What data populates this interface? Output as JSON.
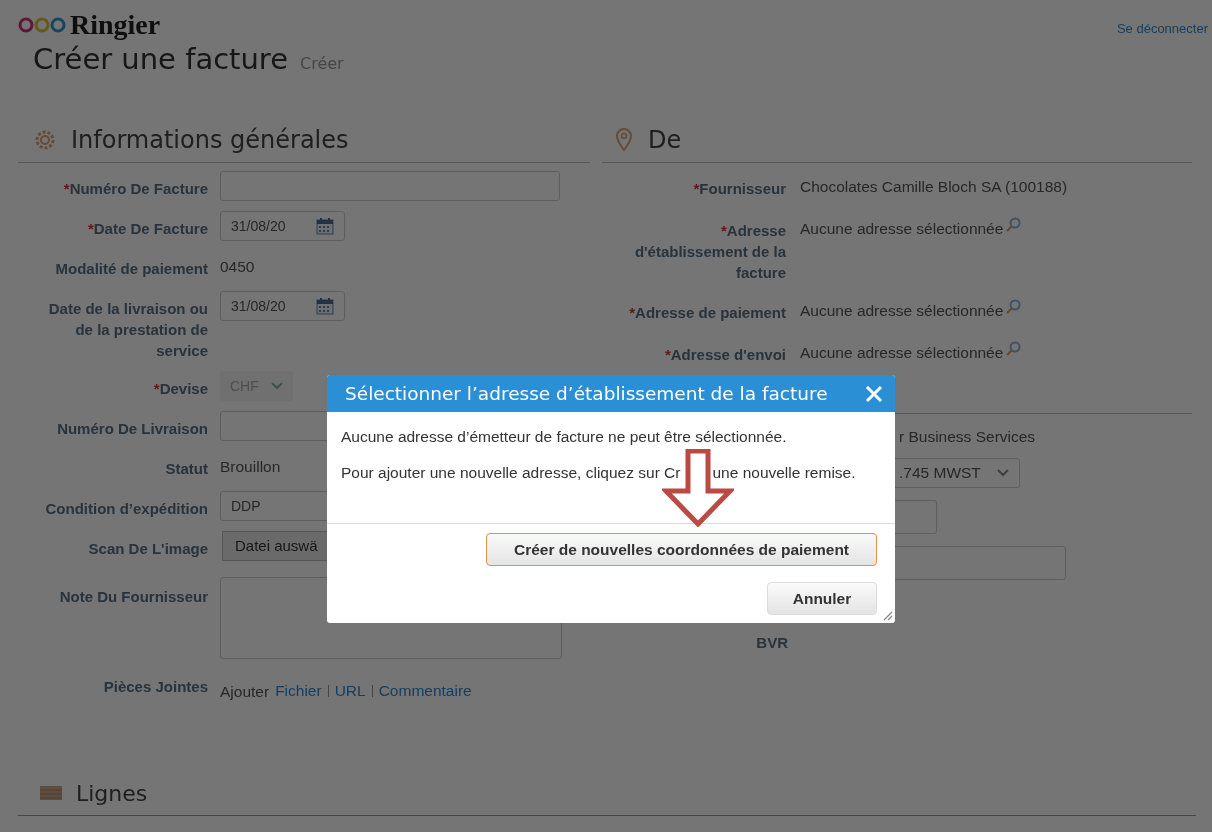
{
  "header": {
    "logo": "Ringier",
    "logout": "Se déconnecter"
  },
  "title": "Créer une facture",
  "subtitle": "Créer",
  "general": {
    "title": "Informations générales",
    "fields": [
      {
        "kind": "input",
        "mark": "*",
        "label": "Numéro De Facture"
      },
      {
        "kind": "date",
        "mark": "*",
        "label": "Date De Facture",
        "value": "31/08/20"
      },
      {
        "kind": "text",
        "label": "Modalité de paiement",
        "value": "0450"
      },
      {
        "kind": "date",
        "label": "Date de la livraison ou de la prestation de service",
        "value": "31/08/20"
      },
      {
        "kind": "select",
        "mark": "*",
        "label": "Devise",
        "value": "CHF"
      },
      {
        "kind": "input",
        "label": "Numéro De Livraison"
      },
      {
        "kind": "text",
        "label": "Statut",
        "value": "Brouillon"
      },
      {
        "kind": "input",
        "label": "Condition d’expédition",
        "value": "DDP"
      },
      {
        "kind": "file",
        "label": "Scan De L'image",
        "value": "Datei auswä"
      },
      {
        "kind": "textarea",
        "label": "Note Du Fournisseur"
      },
      {
        "kind": "links",
        "label": "Pièces Jointes",
        "value": "Ajouter",
        "links": [
          "Fichier",
          "URL",
          "Commentaire"
        ]
      }
    ]
  },
  "from": {
    "title": "De",
    "fields": [
      {
        "kind": "text",
        "mark": "*",
        "label": "Fournisseur",
        "value": "Chocolates Camille Bloch SA (100188)"
      },
      {
        "kind": "lookup",
        "mark": "*",
        "label": "Adresse d'établissement de la facture",
        "value": "Aucune adresse sélectionnée"
      },
      {
        "kind": "lookup",
        "mark": "*",
        "label": "Adresse de paiement",
        "value": "Aucune adresse sélectionnée"
      },
      {
        "kind": "lookup",
        "mark": "*",
        "label": "Adresse d'envoi",
        "value": "Aucune adresse sélectionnée"
      }
    ]
  },
  "covered": {
    "fields": [
      {
        "kind": "text",
        "value": "r Business Services"
      },
      {
        "kind": "select",
        "value": ".745 MWST"
      },
      {
        "kind": "short"
      },
      {
        "kind": "input"
      },
      {
        "kind": "label",
        "label": "BVR"
      }
    ]
  },
  "lines": {
    "title": "Lignes"
  },
  "dialog": {
    "title": "Sélectionner l’adresse d’établissement de la facture",
    "message": "Aucune adresse d’émetteur de facture ne peut être sélectionnée.",
    "hint_parts": [
      "Pour ajouter une nouvelle adresse, cliquez sur Cr",
      "une nouvelle remise."
    ],
    "buttons": [
      {
        "kind": "primary",
        "label": "Créer de nouvelles coordonnées de paiement"
      },
      {
        "kind": "secondary",
        "label": "Annuler"
      }
    ]
  }
}
